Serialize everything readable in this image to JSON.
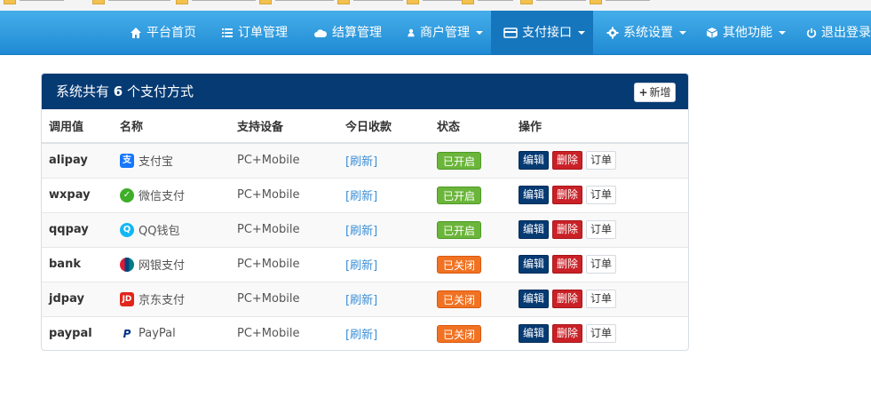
{
  "colors": {
    "navbar": "#1f8ad3",
    "panel_header": "#063a73",
    "status_on": "#6bb53a",
    "status_off": "#f07222",
    "edit_button": "#063a73",
    "delete_button": "#c92127",
    "link": "#3b8fd6"
  },
  "nav": {
    "items": [
      {
        "label": "平台首页",
        "icon": "home-icon"
      },
      {
        "label": "订单管理",
        "icon": "list-icon"
      },
      {
        "label": "结算管理",
        "icon": "cloud-icon"
      },
      {
        "label": "商户管理",
        "icon": "user-icon"
      },
      {
        "label": "支付接口",
        "icon": "credit-card-icon"
      },
      {
        "label": "系统设置",
        "icon": "gear-icon"
      },
      {
        "label": "其他功能",
        "icon": "cube-icon"
      },
      {
        "label": "退出登录",
        "icon": "power-icon"
      }
    ]
  },
  "panel": {
    "title_prefix": "系统共有",
    "title_count": "6",
    "title_suffix": "个支付方式",
    "add_label": "新增"
  },
  "table": {
    "headers": [
      "调用值",
      "名称",
      "支持设备",
      "今日收款",
      "状态",
      "操作"
    ],
    "rows": [
      {
        "code": "alipay",
        "name": "支付宝",
        "icon": "alipay-icon",
        "devices": "PC+Mobile",
        "today": "[刷新]",
        "status": "已开启",
        "enabled": true
      },
      {
        "code": "wxpay",
        "name": "微信支付",
        "icon": "wechat-pay-icon",
        "devices": "PC+Mobile",
        "today": "[刷新]",
        "status": "已开启",
        "enabled": true
      },
      {
        "code": "qqpay",
        "name": "QQ钱包",
        "icon": "qq-wallet-icon",
        "devices": "PC+Mobile",
        "today": "[刷新]",
        "status": "已开启",
        "enabled": true
      },
      {
        "code": "bank",
        "name": "网银支付",
        "icon": "unionpay-icon",
        "devices": "PC+Mobile",
        "today": "[刷新]",
        "status": "已关闭",
        "enabled": false
      },
      {
        "code": "jdpay",
        "name": "京东支付",
        "icon": "jd-icon",
        "devices": "PC+Mobile",
        "today": "[刷新]",
        "status": "已关闭",
        "enabled": false
      },
      {
        "code": "paypal",
        "name": "PayPal",
        "icon": "paypal-icon",
        "devices": "PC+Mobile",
        "today": "[刷新]",
        "status": "已关闭",
        "enabled": false
      }
    ],
    "action_labels": {
      "edit": "编辑",
      "delete": "删除",
      "orders": "订单"
    }
  }
}
